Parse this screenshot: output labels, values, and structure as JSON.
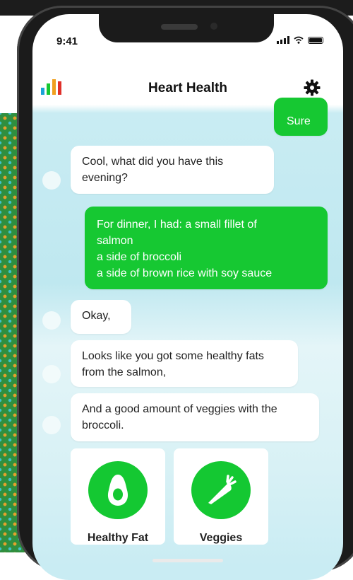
{
  "status_bar": {
    "time": "9:41"
  },
  "header": {
    "title": "Heart Health",
    "app_icon": "bar-chart-icon",
    "settings_icon": "gear-icon"
  },
  "chat": {
    "messages": [
      {
        "from": "user",
        "text": "Sure"
      },
      {
        "from": "bot",
        "text": "Cool, what did you have this evening?"
      },
      {
        "from": "user",
        "lines": [
          "For dinner, I had: a small fillet of",
          "salmon",
          "a side of broccoli",
          "a side of brown rice with soy sauce"
        ]
      },
      {
        "from": "bot",
        "text": "Okay,"
      },
      {
        "from": "bot",
        "text": "Looks like you got some healthy fats from the salmon,"
      },
      {
        "from": "bot",
        "text": "And a good amount of veggies with the broccoli."
      }
    ],
    "cards": [
      {
        "label": "Healthy Fat",
        "icon": "avocado-icon"
      },
      {
        "label": "Veggies",
        "icon": "carrot-icon"
      }
    ]
  },
  "colors": {
    "accent_green": "#16c832",
    "chart_bars": [
      "#1aa3d6",
      "#16c832",
      "#f0a020",
      "#e0302a"
    ]
  }
}
